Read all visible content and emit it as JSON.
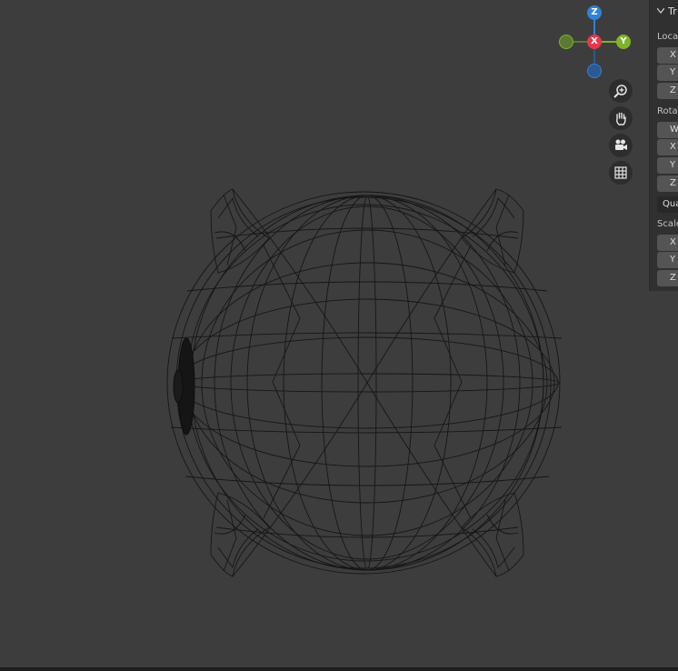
{
  "gizmo": {
    "z_label": "Z",
    "x_label": "X",
    "y_label": "Y",
    "colors": {
      "x": "#e5374d",
      "y": "#7fb32a",
      "z": "#2f83d8",
      "neg_y": "#5a7a33",
      "neg_z": "#2a5a8f"
    }
  },
  "tools": [
    "zoom-icon",
    "hand-pan-icon",
    "camera-icon",
    "grid-icon"
  ],
  "panel": {
    "title": "Tr",
    "location_label": "Loca",
    "location_fields": [
      "X",
      "Y",
      "Z"
    ],
    "rotation_label": "Rota",
    "rotation_fields": [
      "W",
      "X",
      "Y",
      "Z"
    ],
    "rotation_mode": "Qua",
    "scale_label": "Scale",
    "scale_fields": [
      "X",
      "Y",
      "Z"
    ]
  }
}
